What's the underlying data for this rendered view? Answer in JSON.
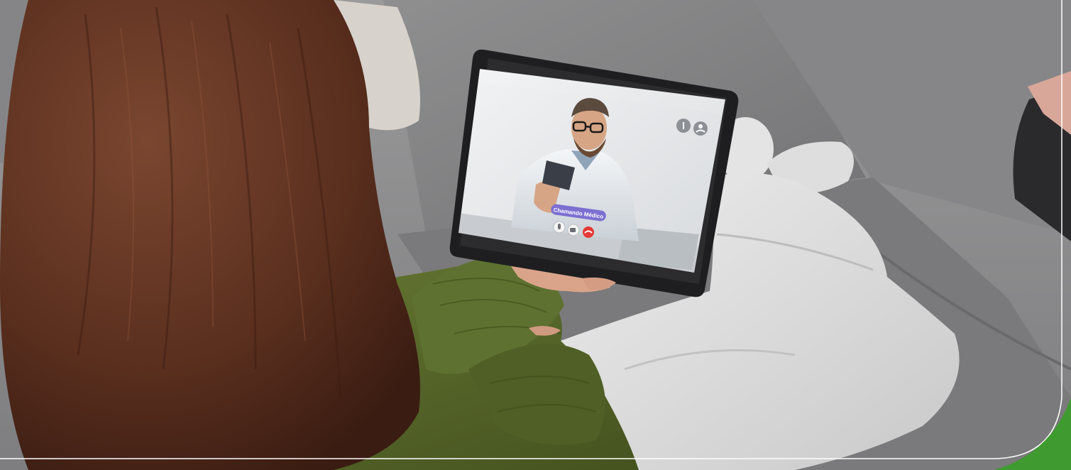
{
  "call_screen": {
    "status_label": "Chamando Médico",
    "controls": [
      "info-icon",
      "add-user-icon",
      "microphone-icon",
      "camera-icon",
      "end-call-icon"
    ]
  },
  "colors": {
    "sofa": "#8e8e8f",
    "sweater": "#5a6b2e",
    "hair": "#5a2f1e",
    "pants": "#dcdcdc",
    "tablet_bezel": "#1e1e20",
    "call_pill": "#7b6fd0",
    "end_call": "#e53935",
    "corner_accent": "#3f9a2f",
    "frame_line": "#ffffff"
  }
}
